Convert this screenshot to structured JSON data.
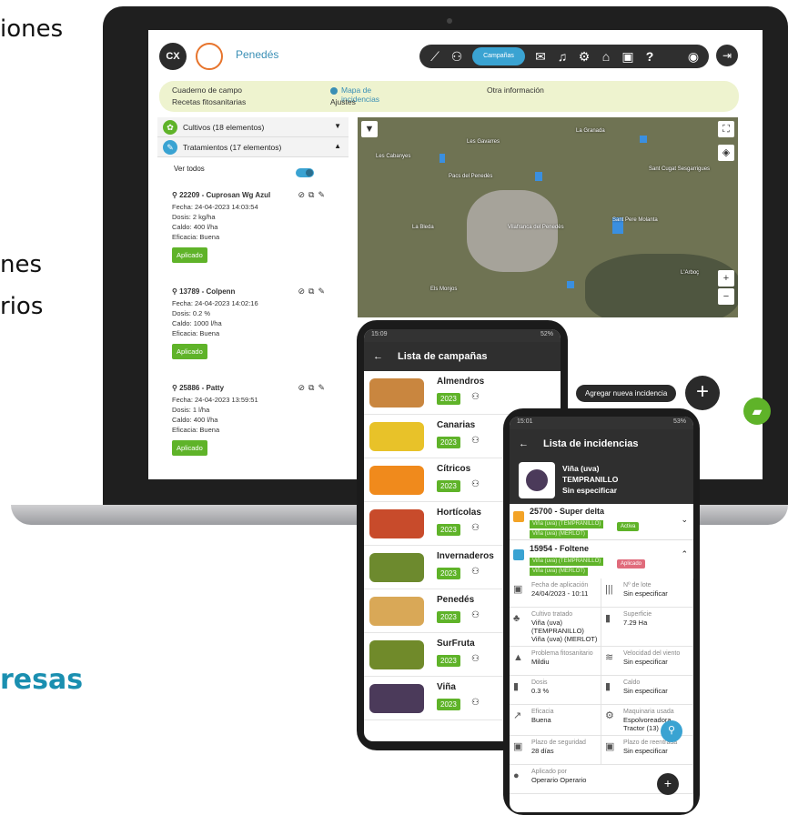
{
  "background": {
    "line1": "iones",
    "line2": "nes",
    "line3": "rios",
    "bottom": "resas"
  },
  "laptop": {
    "brand": "Penedés",
    "campaign_pill": "Campañas",
    "menu": {
      "cuaderno": "Cuaderno de campo",
      "recetas": "Recetas fitosanitarias",
      "mapa": "Mapa de incidencias",
      "ajustes": "Ajustes",
      "otra": "Otra información"
    },
    "sidebar": {
      "cultivos": "Cultivos (18 elementos)",
      "tratamientos": "Tratamientos (17 elementos)",
      "ver_todos": "Ver todos",
      "cards": [
        {
          "title": "22209 - Cuprosan Wg Azul",
          "fecha": "Fecha: 24-04-2023 14:03:54",
          "dosis": "Dosis: 2 kg/ha",
          "caldo": "Caldo: 400 l/ha",
          "eficacia": "Eficacia: Buena",
          "status": "Aplicado"
        },
        {
          "title": "13789 - Colpenn",
          "fecha": "Fecha: 24-04-2023 14:02:16",
          "dosis": "Dosis: 0.2 %",
          "caldo": "Caldo: 1000 l/ha",
          "eficacia": "Eficacia: Buena",
          "status": "Aplicado"
        },
        {
          "title": "25886 - Patty",
          "fecha": "Fecha: 24-04-2023 13:59:51",
          "dosis": "Dosis: 1 l/ha",
          "caldo": "Caldo: 400 l/ha",
          "eficacia": "Eficacia: Buena",
          "status": "Aplicado"
        }
      ]
    },
    "map_labels": [
      "Les Gavarres",
      "La Granada",
      "Pacs del Penedès",
      "Vilafranca del Penedès",
      "Sant Cugat Sesgarrigues",
      "Sant Pere Molanta",
      "La Bleda",
      "Les Cabanyes",
      "Els Monjos",
      "L'Arboç"
    ],
    "add_incidence": "Agregar nueva incidencia"
  },
  "phone1": {
    "time": "15:09",
    "battery": "52%",
    "title": "Lista de campañas",
    "campaigns": [
      {
        "name": "Almendros",
        "year": "2023",
        "color": "#c9863f"
      },
      {
        "name": "Canarias",
        "year": "2023",
        "color": "#e8c229"
      },
      {
        "name": "Cítricos",
        "year": "2023",
        "color": "#f08a1c"
      },
      {
        "name": "Hortícolas",
        "year": "2023",
        "color": "#c84b2b"
      },
      {
        "name": "Invernaderos",
        "year": "2023",
        "color": "#6d8a2e"
      },
      {
        "name": "Penedés",
        "year": "2023",
        "color": "#d9a857"
      },
      {
        "name": "SurFruta",
        "year": "2023",
        "color": "#708a2a"
      },
      {
        "name": "Viña",
        "year": "2023",
        "color": "#4b3a5a"
      }
    ]
  },
  "phone2": {
    "time": "15:01",
    "battery": "53%",
    "title": "Lista de incidencias",
    "crop": {
      "line1": "Viña (uva)",
      "line2": "TEMPRANILLO",
      "line3": "Sin especificar"
    },
    "inc1": {
      "title": "25700 - Super delta",
      "tag1": "Viña (uva) (TEMPRANILLO)",
      "tag2": "Viña (uva) (MERLOT)",
      "status": "Activa"
    },
    "inc2": {
      "title": "15954 - Foltene",
      "tag1": "Viña (uva) (TEMPRANILLO)",
      "tag2": "Viña (uva) (MERLOT)",
      "status": "Aplicado"
    },
    "fields": [
      {
        "label": "Fecha de aplicación",
        "value": "24/04/2023 - 10:11",
        "icon": "calendar-icon",
        "glyph": "▣"
      },
      {
        "label": "Nº de lote",
        "value": "Sin especificar",
        "icon": "barcode-icon",
        "glyph": "|||"
      },
      {
        "label": "Cultivo tratado",
        "value": "Viña (uva) (TEMPRANILLO) Viña (uva) (MERLOT)",
        "icon": "plant-icon",
        "glyph": "♣"
      },
      {
        "label": "Superficie",
        "value": "7.29 Ha",
        "icon": "bars-icon",
        "glyph": "▮"
      },
      {
        "label": "Problema fitosanitario",
        "value": "Mildiu",
        "icon": "warning-icon",
        "glyph": "▲"
      },
      {
        "label": "Velocidad del viento",
        "value": "Sin especificar",
        "icon": "wind-icon",
        "glyph": "≋"
      },
      {
        "label": "Dosis",
        "value": "0.3 %",
        "icon": "bars-icon",
        "glyph": "▮"
      },
      {
        "label": "Caldo",
        "value": "Sin especificar",
        "icon": "bars-icon",
        "glyph": "▮"
      },
      {
        "label": "Eficacia",
        "value": "Buena",
        "icon": "trend-icon",
        "glyph": "↗"
      },
      {
        "label": "Maquinaria usada",
        "value": "Espolvoreadora Tractor (13)",
        "icon": "tractor-icon",
        "glyph": "⚙"
      },
      {
        "label": "Plazo de seguridad",
        "value": "28 días",
        "icon": "calendar-icon",
        "glyph": "▣"
      },
      {
        "label": "Plazo de reentrada",
        "value": "Sin especificar",
        "icon": "calendar-icon",
        "glyph": "▣"
      },
      {
        "label": "Aplicado por",
        "value": "Operario Operario",
        "icon": "person-icon",
        "glyph": "●"
      }
    ]
  }
}
